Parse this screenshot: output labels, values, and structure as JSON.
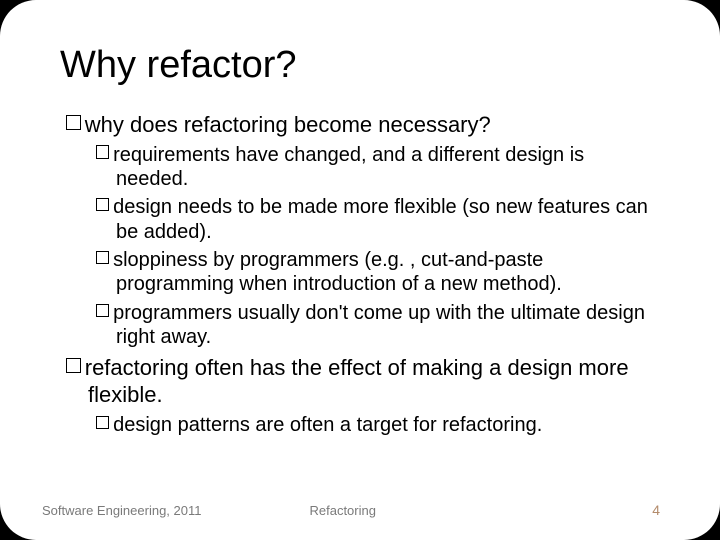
{
  "title": "Why refactor?",
  "b1": {
    "q": "why does refactoring become necessary?",
    "s1": "requirements have changed, and a different design is needed.",
    "s2": "design needs to be made more flexible (so new features can be added).",
    "s3": "sloppiness by programmers (e.g. , cut-and-paste programming when introduction of a new method).",
    "s4": "programmers usually don't come up with the ultimate design right away."
  },
  "b2": {
    "q": "refactoring often has the effect of making a design more flexible.",
    "s1": "design patterns are often a target for refactoring."
  },
  "footer": {
    "left": "Software Engineering, 2011",
    "center": "Refactoring",
    "page": "4"
  }
}
